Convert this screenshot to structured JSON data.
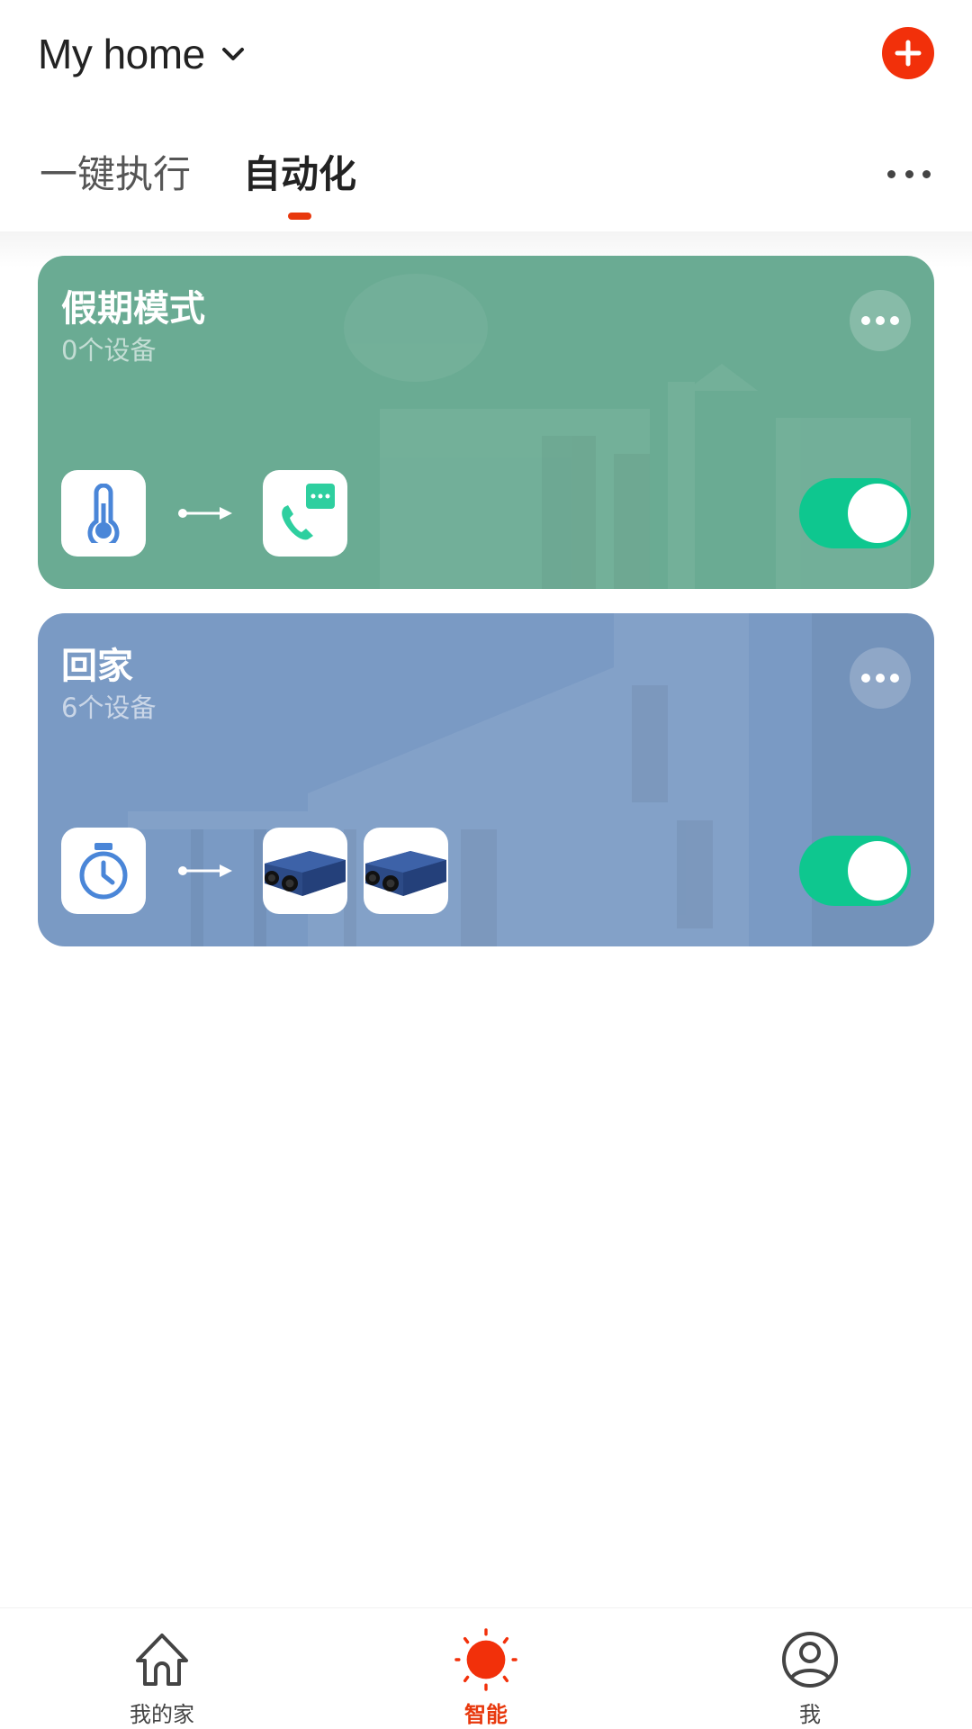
{
  "header": {
    "home_title": "My home",
    "add_button_label": "+"
  },
  "tabs": {
    "items": [
      {
        "label": "一键执行",
        "active": false
      },
      {
        "label": "自动化",
        "active": true
      }
    ]
  },
  "automations": [
    {
      "title": "假期模式",
      "subtitle": "0个设备",
      "color": "#6aab93",
      "condition_icon": "thermometer-icon",
      "action_icons": [
        "phone-message-icon"
      ],
      "enabled": true
    },
    {
      "title": "回家",
      "subtitle": "6个设备",
      "color": "#7a9ac4",
      "condition_icon": "timer-icon",
      "action_icons": [
        "ventilation-unit-device",
        "ventilation-unit-device"
      ],
      "enabled": true
    }
  ],
  "bottom_nav": {
    "items": [
      {
        "label": "我的家",
        "icon": "home-icon",
        "active": false
      },
      {
        "label": "智能",
        "icon": "sun-icon",
        "active": true
      },
      {
        "label": "我",
        "icon": "profile-icon",
        "active": false
      }
    ]
  },
  "colors": {
    "accent": "#e8380d",
    "toggle_on": "#0ec78f"
  }
}
